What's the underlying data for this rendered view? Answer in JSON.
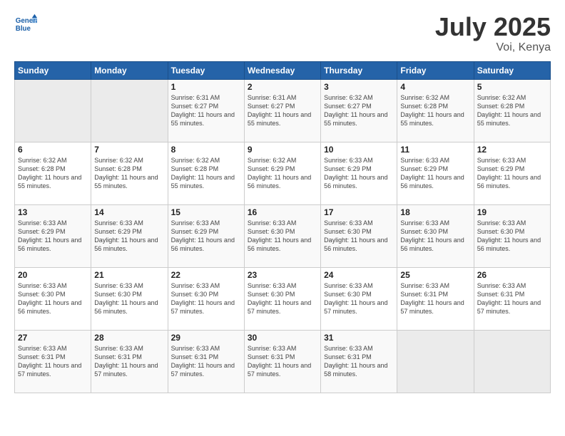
{
  "header": {
    "logo_line1": "General",
    "logo_line2": "Blue",
    "month": "July 2025",
    "location": "Voi, Kenya"
  },
  "days_of_week": [
    "Sunday",
    "Monday",
    "Tuesday",
    "Wednesday",
    "Thursday",
    "Friday",
    "Saturday"
  ],
  "weeks": [
    [
      {
        "day": "",
        "info": ""
      },
      {
        "day": "",
        "info": ""
      },
      {
        "day": "1",
        "info": "Sunrise: 6:31 AM\nSunset: 6:27 PM\nDaylight: 11 hours and 55 minutes."
      },
      {
        "day": "2",
        "info": "Sunrise: 6:31 AM\nSunset: 6:27 PM\nDaylight: 11 hours and 55 minutes."
      },
      {
        "day": "3",
        "info": "Sunrise: 6:32 AM\nSunset: 6:27 PM\nDaylight: 11 hours and 55 minutes."
      },
      {
        "day": "4",
        "info": "Sunrise: 6:32 AM\nSunset: 6:28 PM\nDaylight: 11 hours and 55 minutes."
      },
      {
        "day": "5",
        "info": "Sunrise: 6:32 AM\nSunset: 6:28 PM\nDaylight: 11 hours and 55 minutes."
      }
    ],
    [
      {
        "day": "6",
        "info": "Sunrise: 6:32 AM\nSunset: 6:28 PM\nDaylight: 11 hours and 55 minutes."
      },
      {
        "day": "7",
        "info": "Sunrise: 6:32 AM\nSunset: 6:28 PM\nDaylight: 11 hours and 55 minutes."
      },
      {
        "day": "8",
        "info": "Sunrise: 6:32 AM\nSunset: 6:28 PM\nDaylight: 11 hours and 55 minutes."
      },
      {
        "day": "9",
        "info": "Sunrise: 6:32 AM\nSunset: 6:29 PM\nDaylight: 11 hours and 56 minutes."
      },
      {
        "day": "10",
        "info": "Sunrise: 6:33 AM\nSunset: 6:29 PM\nDaylight: 11 hours and 56 minutes."
      },
      {
        "day": "11",
        "info": "Sunrise: 6:33 AM\nSunset: 6:29 PM\nDaylight: 11 hours and 56 minutes."
      },
      {
        "day": "12",
        "info": "Sunrise: 6:33 AM\nSunset: 6:29 PM\nDaylight: 11 hours and 56 minutes."
      }
    ],
    [
      {
        "day": "13",
        "info": "Sunrise: 6:33 AM\nSunset: 6:29 PM\nDaylight: 11 hours and 56 minutes."
      },
      {
        "day": "14",
        "info": "Sunrise: 6:33 AM\nSunset: 6:29 PM\nDaylight: 11 hours and 56 minutes."
      },
      {
        "day": "15",
        "info": "Sunrise: 6:33 AM\nSunset: 6:29 PM\nDaylight: 11 hours and 56 minutes."
      },
      {
        "day": "16",
        "info": "Sunrise: 6:33 AM\nSunset: 6:30 PM\nDaylight: 11 hours and 56 minutes."
      },
      {
        "day": "17",
        "info": "Sunrise: 6:33 AM\nSunset: 6:30 PM\nDaylight: 11 hours and 56 minutes."
      },
      {
        "day": "18",
        "info": "Sunrise: 6:33 AM\nSunset: 6:30 PM\nDaylight: 11 hours and 56 minutes."
      },
      {
        "day": "19",
        "info": "Sunrise: 6:33 AM\nSunset: 6:30 PM\nDaylight: 11 hours and 56 minutes."
      }
    ],
    [
      {
        "day": "20",
        "info": "Sunrise: 6:33 AM\nSunset: 6:30 PM\nDaylight: 11 hours and 56 minutes."
      },
      {
        "day": "21",
        "info": "Sunrise: 6:33 AM\nSunset: 6:30 PM\nDaylight: 11 hours and 56 minutes."
      },
      {
        "day": "22",
        "info": "Sunrise: 6:33 AM\nSunset: 6:30 PM\nDaylight: 11 hours and 57 minutes."
      },
      {
        "day": "23",
        "info": "Sunrise: 6:33 AM\nSunset: 6:30 PM\nDaylight: 11 hours and 57 minutes."
      },
      {
        "day": "24",
        "info": "Sunrise: 6:33 AM\nSunset: 6:30 PM\nDaylight: 11 hours and 57 minutes."
      },
      {
        "day": "25",
        "info": "Sunrise: 6:33 AM\nSunset: 6:31 PM\nDaylight: 11 hours and 57 minutes."
      },
      {
        "day": "26",
        "info": "Sunrise: 6:33 AM\nSunset: 6:31 PM\nDaylight: 11 hours and 57 minutes."
      }
    ],
    [
      {
        "day": "27",
        "info": "Sunrise: 6:33 AM\nSunset: 6:31 PM\nDaylight: 11 hours and 57 minutes."
      },
      {
        "day": "28",
        "info": "Sunrise: 6:33 AM\nSunset: 6:31 PM\nDaylight: 11 hours and 57 minutes."
      },
      {
        "day": "29",
        "info": "Sunrise: 6:33 AM\nSunset: 6:31 PM\nDaylight: 11 hours and 57 minutes."
      },
      {
        "day": "30",
        "info": "Sunrise: 6:33 AM\nSunset: 6:31 PM\nDaylight: 11 hours and 57 minutes."
      },
      {
        "day": "31",
        "info": "Sunrise: 6:33 AM\nSunset: 6:31 PM\nDaylight: 11 hours and 58 minutes."
      },
      {
        "day": "",
        "info": ""
      },
      {
        "day": "",
        "info": ""
      }
    ]
  ]
}
